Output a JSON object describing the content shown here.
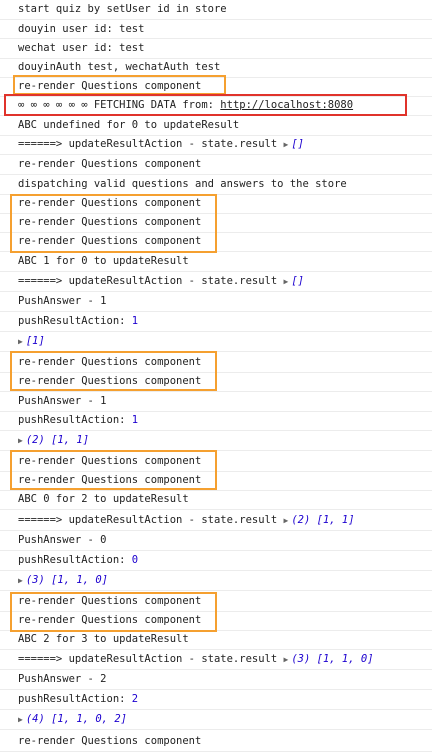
{
  "logs": [
    {
      "text": "start quiz by setUser id in store"
    },
    {
      "text": "douyin user id:  test"
    },
    {
      "text": "wechat user id:  test"
    },
    {
      "text": "douyinAuth test, wechatAuth test"
    },
    {
      "text": "re-render Questions component"
    },
    {
      "text": "∞ ∞ ∞ ∞ ∞ ∞ FETCHING DATA from:  ",
      "link": "http://localhost:8080"
    },
    {
      "text": "ABC undefined for 0 to updateResult"
    },
    {
      "text": "======> updateResultAction - state.result ",
      "arr": "[]"
    },
    {
      "text": "re-render Questions component"
    },
    {
      "text": "dispatching valid questions and answers to the store"
    },
    {
      "text": "re-render Questions component"
    },
    {
      "text": "re-render Questions component"
    },
    {
      "text": "re-render Questions component"
    },
    {
      "text": "ABC 1 for 0 to updateResult"
    },
    {
      "text": "======> updateResultAction - state.result ",
      "arr": "[]"
    },
    {
      "text": "PushAnswer - 1"
    },
    {
      "text": "pushResultAction:  ",
      "num": "1"
    },
    {
      "text": "",
      "arr": "[1]"
    },
    {
      "text": "re-render Questions component"
    },
    {
      "text": "re-render Questions component"
    },
    {
      "text": "PushAnswer - 1"
    },
    {
      "text": "pushResultAction:  ",
      "num": "1"
    },
    {
      "text": "",
      "arr": "(2) [1, 1]"
    },
    {
      "text": "re-render Questions component"
    },
    {
      "text": "re-render Questions component"
    },
    {
      "text": "ABC 0 for 2 to updateResult"
    },
    {
      "text": "======> updateResultAction - state.result ",
      "arr": "(2) [1, 1]"
    },
    {
      "text": "PushAnswer - 0"
    },
    {
      "text": "pushResultAction:  ",
      "num": "0"
    },
    {
      "text": "",
      "arr": "(3) [1, 1, 0]"
    },
    {
      "text": "re-render Questions component"
    },
    {
      "text": "re-render Questions component"
    },
    {
      "text": "ABC 2 for 3 to updateResult"
    },
    {
      "text": "======> updateResultAction - state.result ",
      "arr": "(3) [1, 1, 0]"
    },
    {
      "text": "PushAnswer - 2"
    },
    {
      "text": "pushResultAction:  ",
      "num": "2"
    },
    {
      "text": "",
      "arr": "(4) [1, 1, 0, 2]"
    },
    {
      "text": "re-render Questions component"
    }
  ],
  "colors": {
    "highlight_orange": "#f5a030",
    "highlight_red": "#e0332b",
    "number_blue": "#1c00cf"
  }
}
